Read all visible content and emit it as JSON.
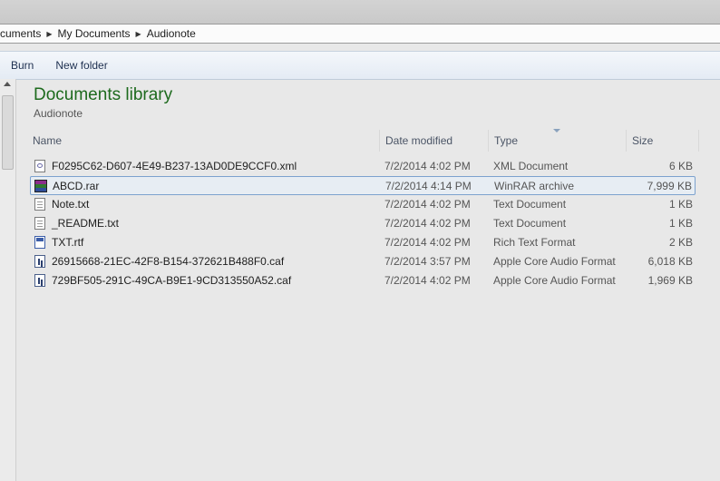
{
  "breadcrumb": {
    "items": [
      "cuments",
      "My Documents",
      "Audionote"
    ]
  },
  "toolbar": {
    "burn": "Burn",
    "new_folder": "New folder"
  },
  "library": {
    "title": "Documents library",
    "subtitle": "Audionote"
  },
  "columns": {
    "name": "Name",
    "date": "Date modified",
    "type": "Type",
    "size": "Size"
  },
  "files": [
    {
      "name": "F0295C62-D607-4E49-B237-13AD0DE9CCF0.xml",
      "date": "7/2/2014 4:02 PM",
      "type": "XML Document",
      "size": "6 KB",
      "icon": "xml-file-icon"
    },
    {
      "name": "ABCD.rar",
      "date": "7/2/2014 4:14 PM",
      "type": "WinRAR archive",
      "size": "7,999 KB",
      "icon": "rar-archive-icon"
    },
    {
      "name": "Note.txt",
      "date": "7/2/2014 4:02 PM",
      "type": "Text Document",
      "size": "1 KB",
      "icon": "text-file-icon"
    },
    {
      "name": "_README.txt",
      "date": "7/2/2014 4:02 PM",
      "type": "Text Document",
      "size": "1 KB",
      "icon": "text-file-icon"
    },
    {
      "name": "TXT.rtf",
      "date": "7/2/2014 4:02 PM",
      "type": "Rich Text Format",
      "size": "2 KB",
      "icon": "rtf-file-icon"
    },
    {
      "name": "26915668-21EC-42F8-B154-372621B488F0.caf",
      "date": "7/2/2014 3:57 PM",
      "type": "Apple Core Audio Format",
      "size": "6,018 KB",
      "icon": "audio-file-icon"
    },
    {
      "name": "729BF505-291C-49CA-B9E1-9CD313550A52.caf",
      "date": "7/2/2014 4:02 PM",
      "type": "Apple Core Audio Format",
      "size": "1,969 KB",
      "icon": "audio-file-icon"
    }
  ],
  "colors": {
    "library_title": "#1d6a1d",
    "selection_border": "#7da2ce"
  }
}
